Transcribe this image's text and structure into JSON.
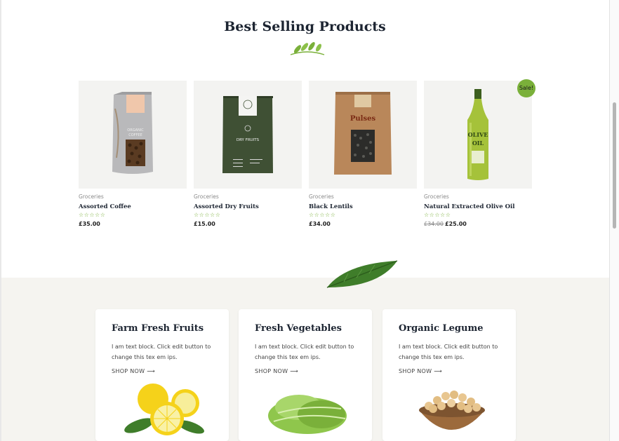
{
  "section": {
    "title": "Best Selling Products"
  },
  "products": [
    {
      "category": "Groceries",
      "name": "Assorted Coffee",
      "rating": 0,
      "stars": "☆☆☆☆☆",
      "price": "£35.00",
      "old_price": "",
      "package_label_top": "ORGANIC",
      "package_label": "COFFEE"
    },
    {
      "category": "Groceries",
      "name": "Assorted Dry Fruits",
      "rating": 0,
      "stars": "☆☆☆☆☆",
      "price": "£15.00",
      "old_price": "",
      "package_label": "DRY FRUITS"
    },
    {
      "category": "Groceries",
      "name": "Black Lentils",
      "rating": 0,
      "stars": "☆☆☆☆☆",
      "price": "£34.00",
      "old_price": "",
      "package_label": "Pulses"
    },
    {
      "category": "Groceries",
      "name": "Natural Extracted Olive Oil",
      "rating": 0,
      "stars": "☆☆☆☆☆",
      "price": "£25.00",
      "old_price": "£34.00",
      "badge": "Sale!",
      "package_label_top": "OLIVE",
      "package_label": "OIL"
    }
  ],
  "categories": [
    {
      "title": "Farm Fresh Fruits",
      "text": "I am text block. Click edit button to change this tex em ips.",
      "link": "SHOP NOW",
      "icon": "arrow-right-icon",
      "image": "lemons"
    },
    {
      "title": "Fresh Vegetables",
      "text": "I am text block. Click edit button to change this tex em ips.",
      "link": "SHOP NOW",
      "icon": "arrow-right-icon",
      "image": "lettuce"
    },
    {
      "title": "Organic Legume",
      "text": "I am text block. Click edit button to change this tex em ips.",
      "link": "SHOP NOW",
      "icon": "arrow-right-icon",
      "image": "chickpeas-bowl"
    }
  ],
  "colors": {
    "accent": "#7ab03a",
    "heading": "#1c2431",
    "band": "#f5f4f0",
    "card_bg": "#f3f3f1"
  }
}
